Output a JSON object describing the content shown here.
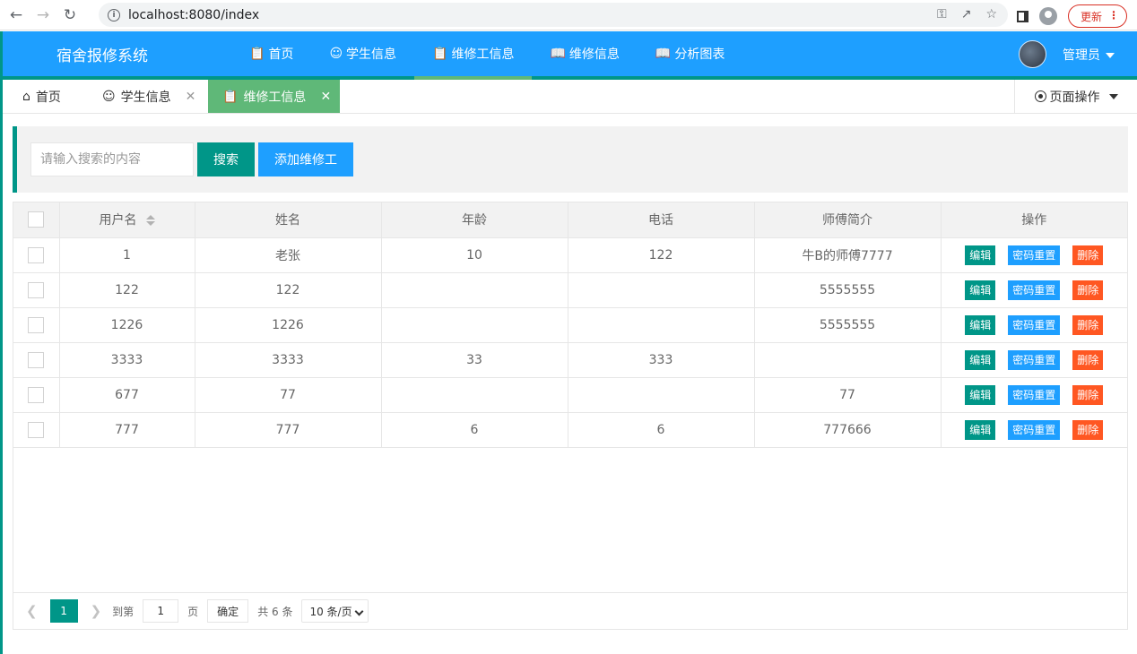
{
  "browser": {
    "url": "localhost:8080/index",
    "update_label": "更新"
  },
  "header": {
    "logo": "宿舍报修系统",
    "nav": [
      {
        "label": "首页",
        "icon": "clipboard-icon"
      },
      {
        "label": "学生信息",
        "icon": "users-icon"
      },
      {
        "label": "维修工信息",
        "icon": "clipboard-icon"
      },
      {
        "label": "维修信息",
        "icon": "book-icon"
      },
      {
        "label": "分析图表",
        "icon": "book-icon"
      }
    ],
    "active_nav": 2,
    "user_name": "管理员"
  },
  "tabs": {
    "home": "首页",
    "students": "学生信息",
    "repairmen": "维修工信息",
    "page_ops": "页面操作"
  },
  "search": {
    "placeholder": "请输入搜索的内容",
    "search_label": "搜索",
    "add_label": "添加维修工"
  },
  "table": {
    "columns": [
      "用户名",
      "姓名",
      "年龄",
      "电话",
      "师傅简介",
      "操作"
    ],
    "rows": [
      {
        "username": "1",
        "name": "老张",
        "age": "10",
        "phone": "122",
        "intro": "牛B的师傅7777"
      },
      {
        "username": "122",
        "name": "122",
        "age": "",
        "phone": "",
        "intro": "5555555"
      },
      {
        "username": "1226",
        "name": "1226",
        "age": "",
        "phone": "",
        "intro": "5555555"
      },
      {
        "username": "3333",
        "name": "3333",
        "age": "33",
        "phone": "333",
        "intro": ""
      },
      {
        "username": "677",
        "name": "77",
        "age": "",
        "phone": "",
        "intro": "77"
      },
      {
        "username": "777",
        "name": "777",
        "age": "6",
        "phone": "6",
        "intro": "777666"
      }
    ],
    "actions": {
      "edit": "编辑",
      "reset": "密码重置",
      "delete": "删除"
    }
  },
  "pager": {
    "current_page": "1",
    "goto_label": "到第",
    "goto_value": "1",
    "page_unit": "页",
    "confirm": "确定",
    "total": "共 6 条",
    "page_size": "10 条/页"
  },
  "colors": {
    "primary": "#1e9fff",
    "green": "#009688",
    "tab_active": "#5fb878",
    "danger": "#ff5722"
  }
}
